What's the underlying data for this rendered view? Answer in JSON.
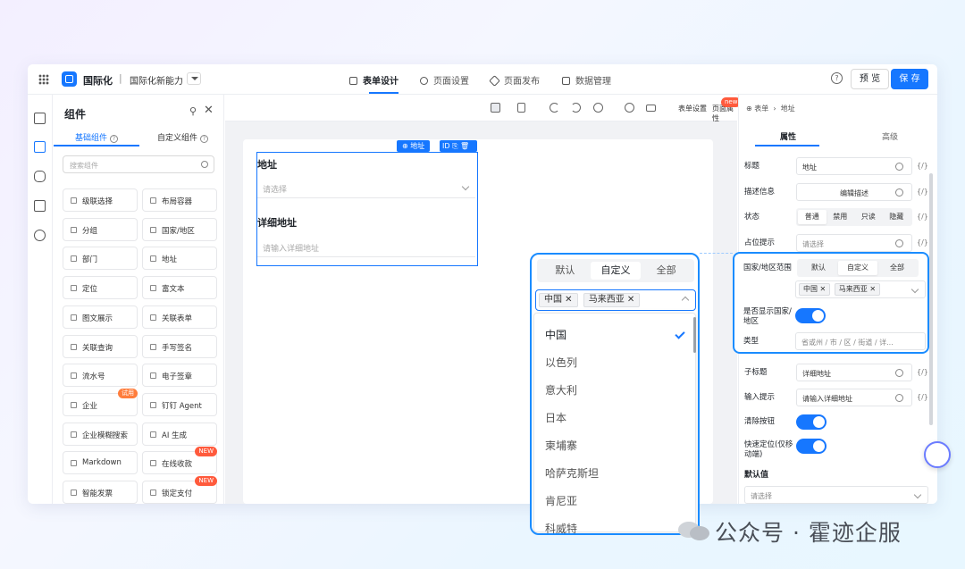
{
  "header": {
    "app_name": "国际化",
    "form_name": "国际化新能力",
    "tabs": [
      {
        "label": "表单设计",
        "active": true
      },
      {
        "label": "页面设置",
        "active": false
      },
      {
        "label": "页面发布",
        "active": false
      },
      {
        "label": "数据管理",
        "active": false
      }
    ],
    "preview_label": "预 览",
    "save_label": "保 存",
    "accent": "#1677ff"
  },
  "components_panel": {
    "title": "组件",
    "tabs": [
      "基础组件",
      "自定义组件"
    ],
    "search_placeholder": "搜索组件",
    "items": [
      {
        "label": "级联选择",
        "icon": "cascade-icon"
      },
      {
        "label": "布局容器",
        "icon": "layout-icon"
      },
      {
        "label": "分组",
        "icon": "group-icon"
      },
      {
        "label": "国家/地区",
        "icon": "globe-icon"
      },
      {
        "label": "部门",
        "icon": "department-icon"
      },
      {
        "label": "地址",
        "icon": "globe-icon"
      },
      {
        "label": "定位",
        "icon": "location-icon"
      },
      {
        "label": "富文本",
        "icon": "richtext-icon"
      },
      {
        "label": "图文展示",
        "icon": "image-text-icon"
      },
      {
        "label": "关联表单",
        "icon": "link-form-icon"
      },
      {
        "label": "关联查询",
        "icon": "query-icon"
      },
      {
        "label": "手写签名",
        "icon": "signature-icon"
      },
      {
        "label": "流水号",
        "icon": "serial-icon"
      },
      {
        "label": "电子签章",
        "icon": "seal-icon"
      },
      {
        "label": "企业",
        "icon": "company-icon",
        "badge": "试用"
      },
      {
        "label": "钉钉 Agent",
        "icon": "agent-icon"
      },
      {
        "label": "企业模糊搜索",
        "icon": "search-icon"
      },
      {
        "label": "AI 生成",
        "icon": "ai-icon"
      },
      {
        "label": "Markdown",
        "icon": "markdown-icon"
      },
      {
        "label": "在线收款",
        "icon": "payment-icon",
        "badge": "NEW"
      },
      {
        "label": "智能发票",
        "icon": "invoice-icon"
      },
      {
        "label": "锁定支付",
        "icon": "lock-pay-icon",
        "badge": "NEW"
      }
    ]
  },
  "toolbar": {
    "form_settings": "表单设置",
    "page_props": "页面属性",
    "new_badge": "new"
  },
  "canvas": {
    "selected_tag": "地址",
    "selected_tag_extra": "ID",
    "fields": [
      {
        "label": "地址",
        "placeholder": "请选择"
      },
      {
        "label": "详细地址",
        "placeholder": "请输入详细地址"
      }
    ]
  },
  "props": {
    "breadcrumb": [
      "表单",
      "地址"
    ],
    "tabs": [
      "属性",
      "高级"
    ],
    "fx": "{/}",
    "rows": {
      "title": {
        "label": "标题",
        "value": "地址"
      },
      "desc": {
        "label": "描述信息",
        "value": "编辑描述"
      },
      "state": {
        "label": "状态",
        "options": [
          "普通",
          "禁用",
          "只读",
          "隐藏"
        ]
      },
      "placeholder": {
        "label": "占位提示",
        "value": "请选择"
      },
      "range": {
        "label": "国家/地区范围",
        "options": [
          "默认",
          "自定义",
          "全部"
        ],
        "tags": [
          "中国",
          "马来西亚"
        ]
      },
      "show_country": {
        "label": "是否显示国家/地区"
      },
      "type": {
        "label": "类型",
        "value": "省或州 / 市 / 区 / 街道 / 详..."
      },
      "subtitle": {
        "label": "子标题",
        "value": "详细地址"
      },
      "input_hint": {
        "label": "输入提示",
        "value": "请输入详细地址"
      },
      "clear": {
        "label": "清除按钮"
      },
      "quick_locate": {
        "label": "快速定位(仅移动端)"
      },
      "default_section": "默认值",
      "default_placeholder": "请选择"
    }
  },
  "dropdown": {
    "modes": [
      "默认",
      "自定义",
      "全部"
    ],
    "active_mode": "自定义",
    "selected_tags": [
      "中国",
      "马来西亚"
    ],
    "options": [
      "中国",
      "以色列",
      "意大利",
      "日本",
      "柬埔寨",
      "哈萨克斯坦",
      "肯尼亚",
      "科威特"
    ],
    "checked": "中国"
  },
  "watermark": "公众号 · 霍迹企服"
}
